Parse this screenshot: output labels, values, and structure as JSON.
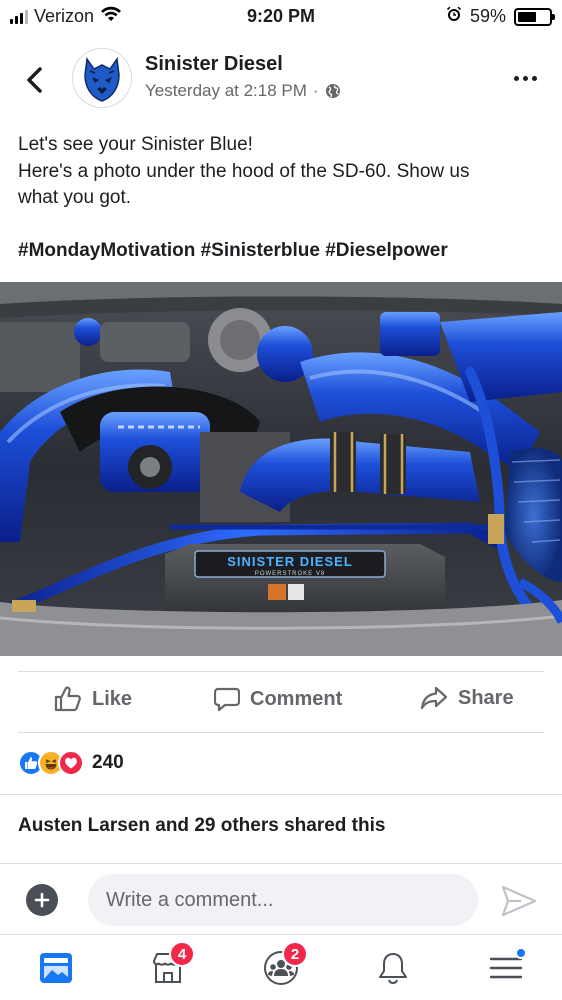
{
  "status_bar": {
    "carrier": "Verizon",
    "time": "9:20 PM",
    "battery_percent": "59%",
    "battery_level": 0.59,
    "icons": [
      "signal-icon",
      "wifi-icon",
      "alarm-icon",
      "battery-icon"
    ]
  },
  "post": {
    "page_name": "Sinister Diesel",
    "timestamp": "Yesterday at 2:18 PM",
    "separator": "·",
    "privacy_icon": "globe-icon",
    "text_lines": [
      "Let's see your Sinister Blue!",
      "Here's a photo under the hood of the SD-60. Show us",
      "what you got."
    ],
    "hashtags": "#MondayMotivation #Sinisterblue #Dieselpower",
    "photo": {
      "icon": "engine-bay-photo",
      "cover_text": "SINISTER DIESEL",
      "cover_subtext": "POWERSTROKE V8"
    }
  },
  "actions": {
    "like_label": "Like",
    "comment_label": "Comment",
    "share_label": "Share"
  },
  "reactions": {
    "types": [
      "like-reaction-icon",
      "haha-reaction-icon",
      "love-reaction-icon"
    ],
    "count": "240"
  },
  "shares_text": "Austen Larsen and 29 others shared this",
  "composer": {
    "placeholder": "Write a comment...",
    "value": ""
  },
  "bottom_nav": {
    "items": [
      {
        "name": "news-feed",
        "icon": "news-feed-icon",
        "badge": ""
      },
      {
        "name": "marketplace",
        "icon": "marketplace-icon",
        "badge": "4"
      },
      {
        "name": "groups",
        "icon": "groups-icon",
        "badge": "2"
      },
      {
        "name": "notifications",
        "icon": "bell-icon",
        "badge": ""
      },
      {
        "name": "menu",
        "icon": "menu-icon",
        "badge": ""
      }
    ]
  },
  "colors": {
    "brand_blue": "#1877f2",
    "badge_red": "#f02849",
    "secondary_text": "#65676b"
  }
}
